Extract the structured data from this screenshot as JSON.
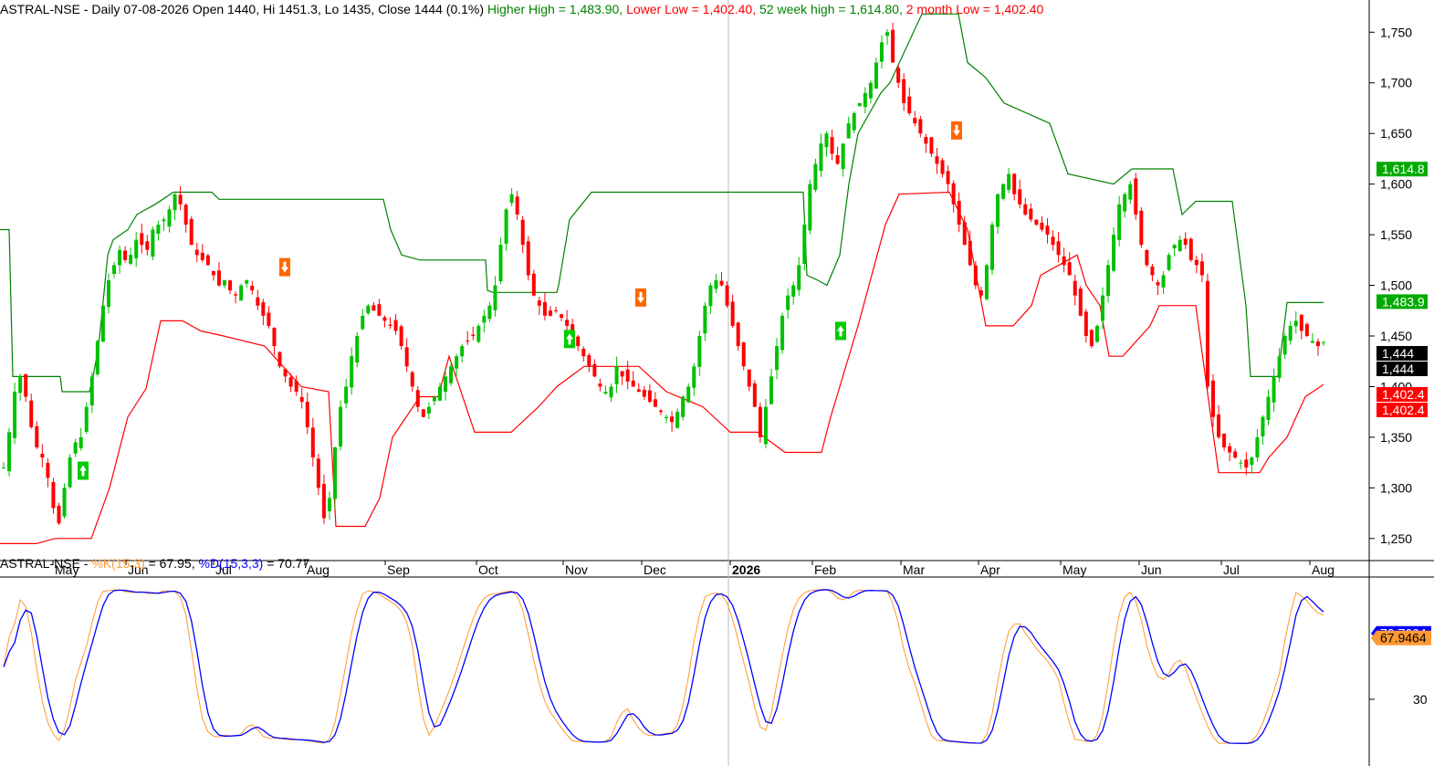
{
  "header": {
    "symbol": "ASTRAL-NSE",
    "interval": "Daily",
    "date": "07-08-2026",
    "ohlc": "Open 1440, Hi 1451.3, Lo 1435, Close 1444 (0.1%)",
    "hh": "Higher High = 1,483.90,",
    "ll": "Lower Low = 1,402.40,",
    "w52": "52 week high = 1,614.80,",
    "m2": "2 month Low = 1,402.40"
  },
  "stoch_header": {
    "symbol": "ASTRAL-NSE -",
    "k": "%K(15,3)",
    "k_val": "= 67.95,",
    "d": "%D(15,3,3)",
    "d_val": "= 70.77"
  },
  "colors": {
    "up": "#00c000",
    "down": "#ff0000",
    "hh": "#008000",
    "ll": "#ff0000",
    "k": "#ff9933",
    "d": "#0000ff",
    "buy_marker": "#00cc00",
    "sell_marker": "#ff6600"
  },
  "chart_data": [
    {
      "type": "candlestick",
      "title": "ASTRAL-NSE - Daily 07-08-2026",
      "ylim": [
        1230,
        1780
      ],
      "y_ticks": [
        1250,
        1300,
        1350,
        1400,
        1450,
        1500,
        1550,
        1600,
        1650,
        1700,
        1750
      ],
      "y_tick_labels": [
        "1,250",
        "1,300",
        "1,350",
        "1,400",
        "1,450",
        "1,500",
        "1,550",
        "1,600",
        "1,650",
        "1,700",
        "1,750"
      ],
      "x_tick_labels": [
        "May",
        "Jun",
        "Jul",
        "Aug",
        "Sep",
        "Oct",
        "Nov",
        "Dec",
        "2026",
        "Feb",
        "Mar",
        "Apr",
        "May",
        "Jun",
        "Jul",
        "Aug"
      ],
      "close": [
        1320,
        1355,
        1395,
        1410,
        1390,
        1360,
        1340,
        1330,
        1310,
        1280,
        1265,
        1300,
        1330,
        1345,
        1350,
        1380,
        1410,
        1445,
        1480,
        1505,
        1520,
        1535,
        1525,
        1530,
        1545,
        1540,
        1535,
        1555,
        1560,
        1565,
        1575,
        1590,
        1580,
        1560,
        1540,
        1530,
        1525,
        1520,
        1510,
        1500,
        1505,
        1495,
        1490,
        1500,
        1505,
        1495,
        1480,
        1470,
        1460,
        1440,
        1420,
        1410,
        1400,
        1395,
        1385,
        1360,
        1330,
        1300,
        1270,
        1290,
        1340,
        1380,
        1400,
        1430,
        1450,
        1470,
        1480,
        1475,
        1470,
        1465,
        1460,
        1455,
        1440,
        1420,
        1400,
        1380,
        1370,
        1380,
        1390,
        1400,
        1410,
        1420,
        1430,
        1440,
        1445,
        1450,
        1460,
        1470,
        1480,
        1500,
        1540,
        1575,
        1590,
        1570,
        1540,
        1510,
        1490,
        1480,
        1470,
        1470,
        1475,
        1468,
        1460,
        1450,
        1440,
        1430,
        1420,
        1410,
        1400,
        1395,
        1400,
        1420,
        1410,
        1405,
        1400,
        1395,
        1390,
        1385,
        1380,
        1375,
        1370,
        1365,
        1375,
        1390,
        1400,
        1420,
        1450,
        1480,
        1500,
        1505,
        1500,
        1480,
        1460,
        1440,
        1420,
        1400,
        1380,
        1350,
        1380,
        1410,
        1440,
        1470,
        1490,
        1500,
        1520,
        1560,
        1600,
        1620,
        1640,
        1650,
        1630,
        1620,
        1640,
        1660,
        1670,
        1680,
        1690,
        1700,
        1720,
        1740,
        1750,
        1720,
        1700,
        1680,
        1670,
        1660,
        1650,
        1640,
        1630,
        1620,
        1610,
        1600,
        1580,
        1560,
        1540,
        1520,
        1500,
        1490,
        1520,
        1560,
        1590,
        1600,
        1610,
        1590,
        1580,
        1570,
        1565,
        1560,
        1555,
        1550,
        1540,
        1530,
        1520,
        1510,
        1490,
        1470,
        1450,
        1440,
        1460,
        1490,
        1520,
        1550,
        1580,
        1590,
        1600,
        1570,
        1540,
        1520,
        1510,
        1500,
        1510,
        1530,
        1540,
        1545,
        1540,
        1525,
        1520,
        1510,
        1400,
        1370,
        1350,
        1340,
        1335,
        1330,
        1325,
        1320,
        1330,
        1350,
        1370,
        1390,
        1410,
        1430,
        1450,
        1460,
        1465,
        1455,
        1450,
        1445,
        1440,
        1444
      ]
    },
    {
      "type": "line",
      "title": "ASTRAL-NSE - %K(15,3) = 67.95, %D(15,3,3) = 70.77",
      "ylim": [
        0,
        100
      ],
      "y_ticks": [
        30
      ],
      "y_tick_labels": [
        "30"
      ],
      "series": [
        {
          "name": "%K(15,3)",
          "last": 67.9464
        },
        {
          "name": "%D(15,3,3)",
          "last": 70.7664
        }
      ]
    }
  ],
  "price_badges": [
    {
      "text": "1,614.8",
      "color": "#00aa00",
      "value": 1614.8
    },
    {
      "text": "1,483.9",
      "color": "#00aa00",
      "value": 1483.9
    },
    {
      "text": "1,444",
      "color": "#000000",
      "value": 1444
    },
    {
      "text": "1,444",
      "color": "#000000",
      "value": 1444
    },
    {
      "text": "1,402.4",
      "color": "#ff0000",
      "value": 1402.4
    },
    {
      "text": "1,402.4",
      "color": "#ff0000",
      "value": 1402.4
    }
  ],
  "stoch_badges": [
    {
      "text": "70.7664",
      "color": "#0000ff",
      "value": 70.7664
    },
    {
      "text": "67.9464",
      "color": "#ff9933",
      "value": 67.9464
    }
  ]
}
